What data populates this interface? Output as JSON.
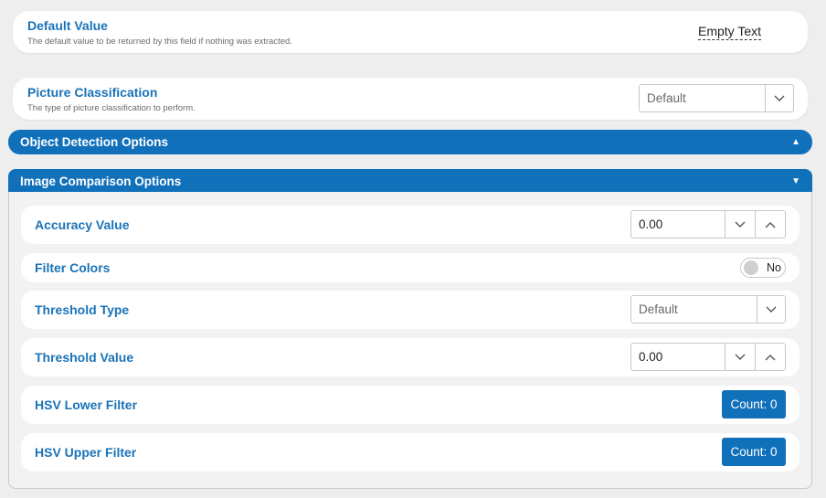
{
  "default_value": {
    "title": "Default Value",
    "description": "The default value to be returned by this field if nothing was extracted.",
    "value": "Empty Text"
  },
  "picture_classification": {
    "title": "Picture Classification",
    "description": "The type of picture classification to perform.",
    "selected": "Default"
  },
  "object_detection": {
    "title": "Object Detection Options",
    "expanded": false
  },
  "image_comparison": {
    "title": "Image Comparison Options",
    "expanded": true,
    "accuracy": {
      "label": "Accuracy Value",
      "value": "0.00"
    },
    "filter_colors": {
      "label": "Filter Colors",
      "state": "No"
    },
    "threshold_type": {
      "label": "Threshold Type",
      "selected": "Default"
    },
    "threshold_value": {
      "label": "Threshold Value",
      "value": "0.00"
    },
    "hsv_lower": {
      "label": "HSV Lower Filter",
      "button": "Count: 0"
    },
    "hsv_upper": {
      "label": "HSV Upper Filter",
      "button": "Count: 0"
    }
  },
  "colors": {
    "accent": "#1070ba",
    "label": "#1a73b8",
    "background": "#eeeeee"
  }
}
